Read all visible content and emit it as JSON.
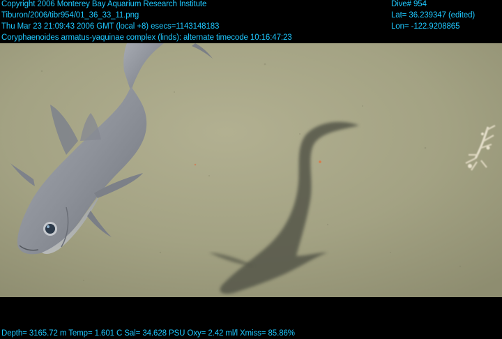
{
  "overlay": {
    "top_left": {
      "line1": "Copyright 2006 Monterey Bay Aquarium Research Institute",
      "line2": "Tiburon/2006/tibr954/01_36_33_11.png",
      "line3": "Thu Mar 23 21:09:43 2006 GMT (local +8)  esecs=1143148183",
      "line4": "Coryphaenoides armatus-yaquinae complex (linds): alternate timecode 10:16:47:23"
    },
    "top_right": {
      "line1": "Dive# 954",
      "line2": "Lat= 36.239347 (edited)",
      "line3": "Lon= -122.9208865"
    },
    "bottom": {
      "line1": "Depth= 3165.72 m  Temp= 1.601 C  Sal= 34.628 PSU  Oxy= 2.42 ml/l  Xmiss= 85.86%"
    },
    "colors": {
      "overlay_text": "#1ec8ff",
      "seafloor": "#a9a889",
      "fish_body": "#8f939c",
      "shadow": "#545644"
    }
  }
}
